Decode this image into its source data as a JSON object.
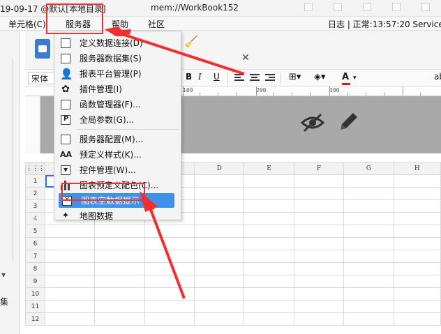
{
  "titlebar": {
    "left_text": "19-09-17 @默认[本地目录]",
    "right_text": "mem://WorkBook152"
  },
  "menubar": {
    "items": [
      "单元格(C)",
      "服务器",
      "帮助",
      "社区"
    ],
    "status": "日志 | 正常:13:57:20 Service"
  },
  "leftpanel": {
    "label": "集"
  },
  "formatbar": {
    "font_name": "宋体",
    "bold": "B",
    "italic": "I",
    "underline": "U",
    "font_color": "A",
    "more": "ab"
  },
  "ruler": {
    "marks": [
      "100",
      "200",
      "300"
    ]
  },
  "grid": {
    "columns": [
      "",
      "",
      "",
      "D",
      "E",
      "F",
      "G",
      "H"
    ],
    "rows": [
      "1",
      "2",
      "3",
      "4",
      "5",
      "6",
      "7",
      "8",
      "9",
      "10",
      "11",
      "12"
    ]
  },
  "menu": {
    "items": [
      {
        "label": "定义数据连接(D)",
        "icon": "database-connection-icon"
      },
      {
        "label": "服务器数据集(S)",
        "icon": "server-dataset-icon"
      },
      {
        "label": "报表平台管理(P)",
        "icon": "user-icon"
      },
      {
        "label": "插件管理(I)",
        "icon": "puzzle-icon"
      },
      {
        "label": "函数管理器(F)...",
        "icon": "function-icon"
      },
      {
        "label": "全局参数(G)...",
        "icon": "parameter-icon"
      },
      {
        "label": "服务器配置(M)...",
        "icon": "server-config-icon"
      },
      {
        "label": "预定义样式(K)...",
        "icon": "style-icon"
      },
      {
        "label": "控件管理(W)...",
        "icon": "widget-icon"
      },
      {
        "label": "图表预定义配色(C)...",
        "icon": "chart-bar-icon"
      },
      {
        "label": "图表空数据提示",
        "icon": "chart-empty-icon"
      },
      {
        "label": "地图数据",
        "icon": "map-icon"
      }
    ]
  },
  "colors": {
    "highlight": "#3f92e8",
    "annotation": "#f03030",
    "band": "#a9a9a9"
  }
}
